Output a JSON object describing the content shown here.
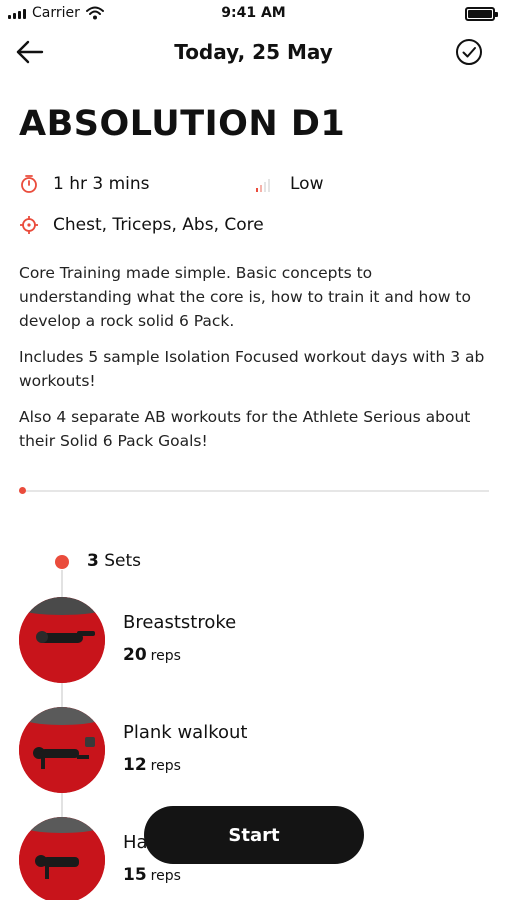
{
  "status_bar": {
    "carrier": "Carrier",
    "time": "9:41 AM"
  },
  "nav": {
    "title": "Today, 25 May",
    "icons": {
      "back": "arrow-left-icon",
      "done": "check-circle-icon"
    }
  },
  "workout": {
    "title": "ABSOLUTION D1",
    "duration": "1 hr 3 mins",
    "intensity": "Low",
    "intensity_level": 1,
    "intensity_levels_total": 4,
    "muscles": "Chest, Triceps, Abs, Core",
    "description": [
      "Core Training made simple. Basic concepts to understanding what the core is, how to train it and how to develop a rock solid 6 Pack.",
      "Includes 5 sample Isolation Focused workout days with 3 ab workouts!",
      "Also 4 separate AB workouts for the Athlete Serious about their Solid 6 Pack Goals!"
    ],
    "progress": 0.0
  },
  "sets": {
    "count": "3",
    "label": "Sets"
  },
  "exercises": [
    {
      "name": "Breaststroke",
      "reps": "20",
      "reps_label": "reps"
    },
    {
      "name": "Plank walkout",
      "reps": "12",
      "reps_label": "reps"
    },
    {
      "name": "Ha",
      "reps": "15",
      "reps_label": "reps"
    }
  ],
  "start_button": {
    "label": "Start"
  },
  "colors": {
    "accent": "#ea4c3c",
    "button_bg": "#141414",
    "thumb_bg": "#c8141b"
  }
}
